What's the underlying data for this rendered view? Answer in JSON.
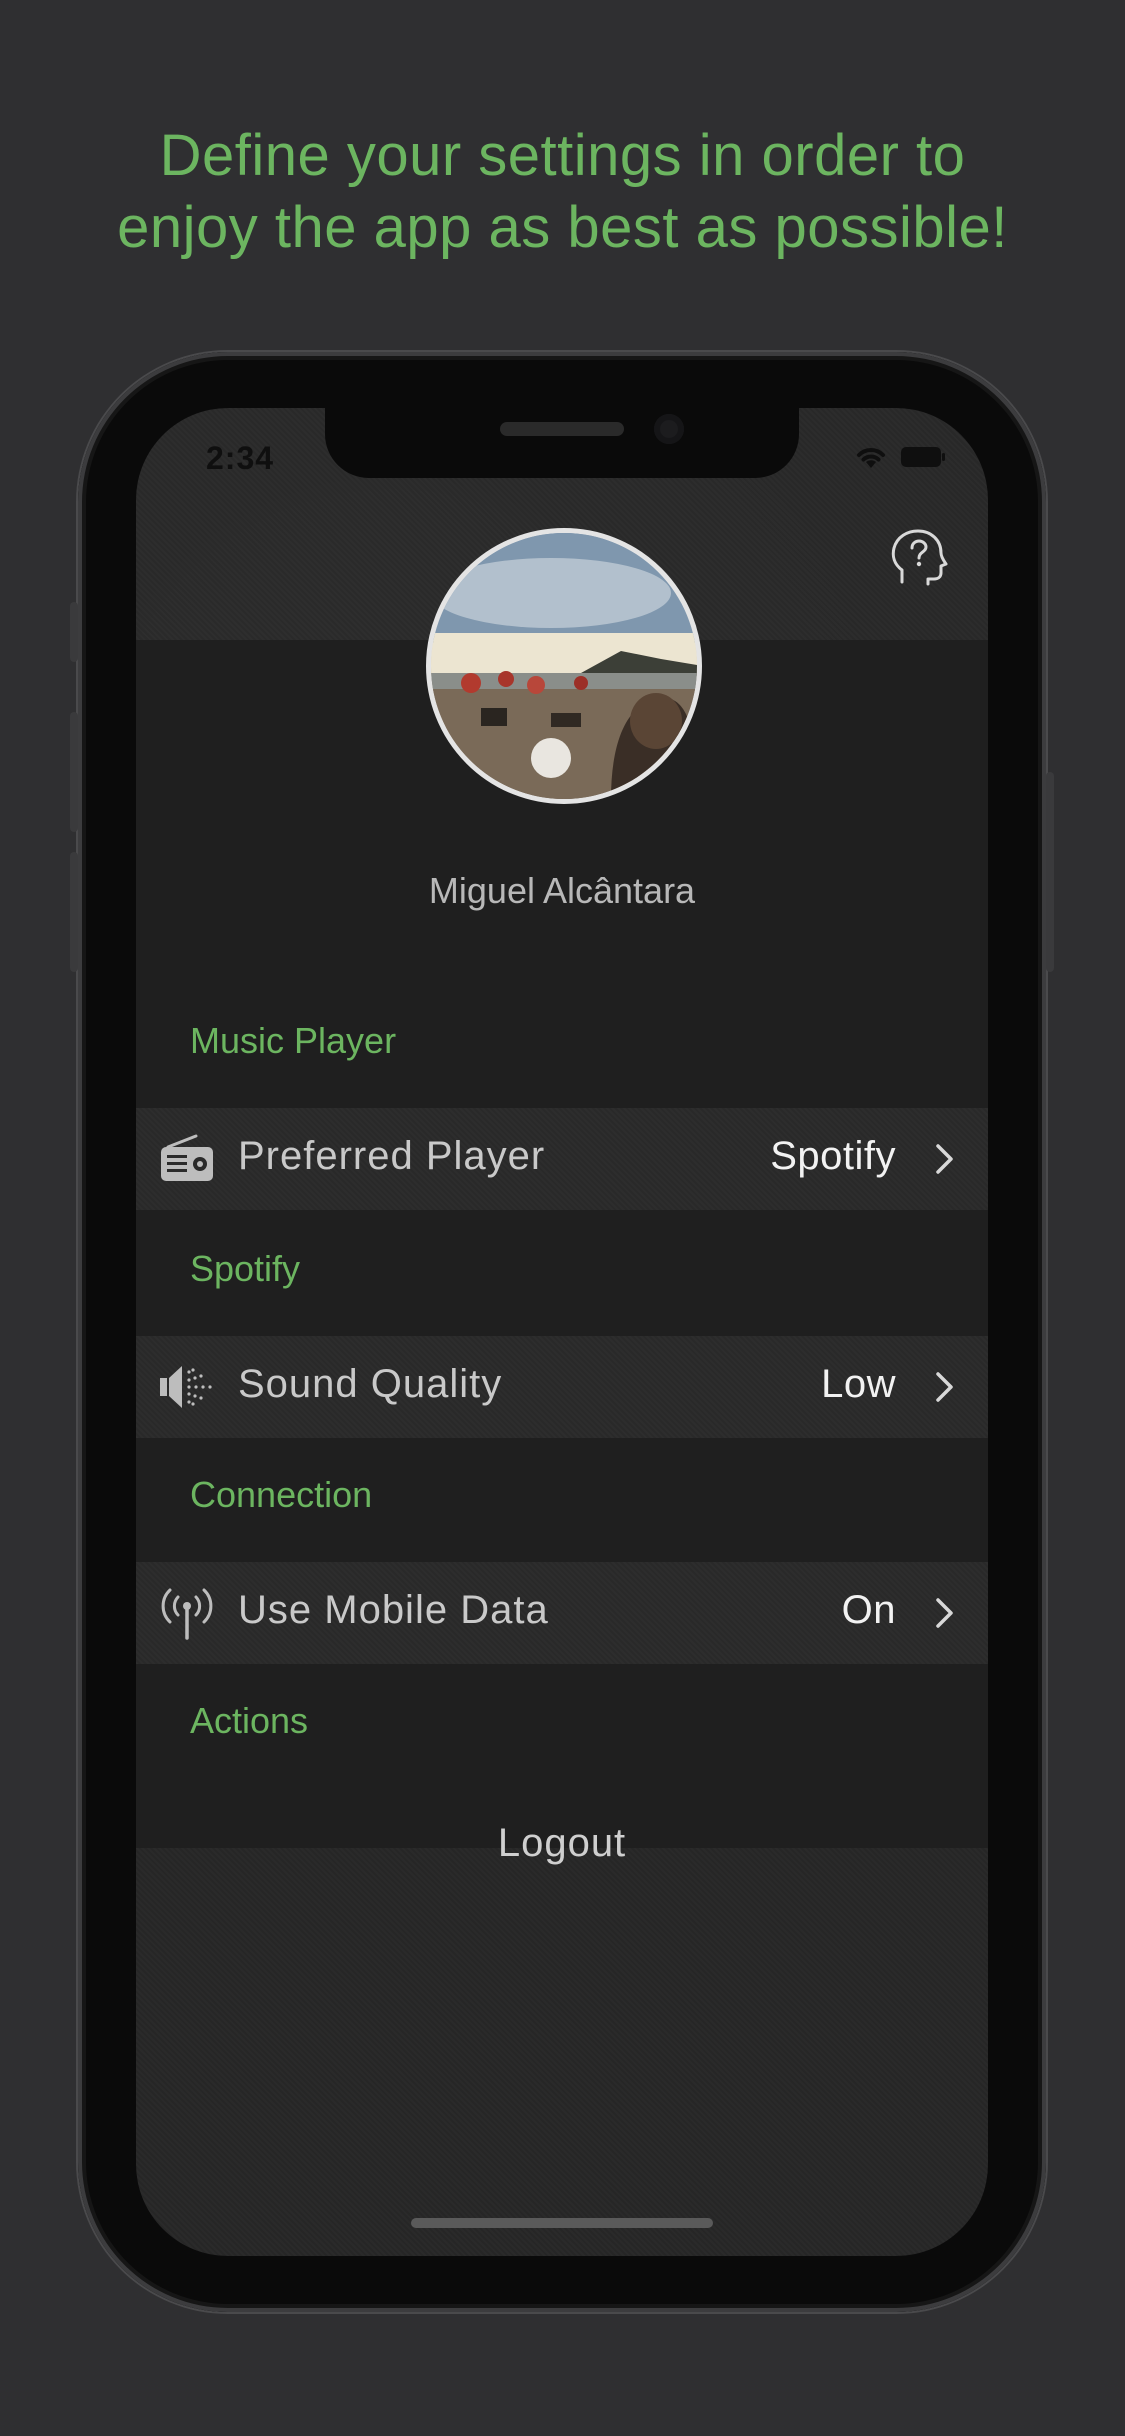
{
  "promo": {
    "line1": "Define your settings in order to",
    "line2": "enjoy the app as best as possible!"
  },
  "status_bar": {
    "time": "2:34"
  },
  "profile": {
    "name": "Miguel Alcântara"
  },
  "sections": {
    "music_player": {
      "title": "Music Player",
      "row": {
        "label": "Preferred Player",
        "value": "Spotify",
        "icon": "radio-icon"
      }
    },
    "spotify": {
      "title": "Spotify",
      "row": {
        "label": "Sound Quality",
        "value": "Low",
        "icon": "speaker-icon"
      }
    },
    "connection": {
      "title": "Connection",
      "row": {
        "label": "Use Mobile Data",
        "value": "On",
        "icon": "antenna-icon"
      }
    },
    "actions": {
      "title": "Actions",
      "logout_label": "Logout"
    }
  },
  "colors": {
    "accent_green": "#6cb560",
    "background": "#2f2f31",
    "row_value": "#f2f2f2"
  }
}
